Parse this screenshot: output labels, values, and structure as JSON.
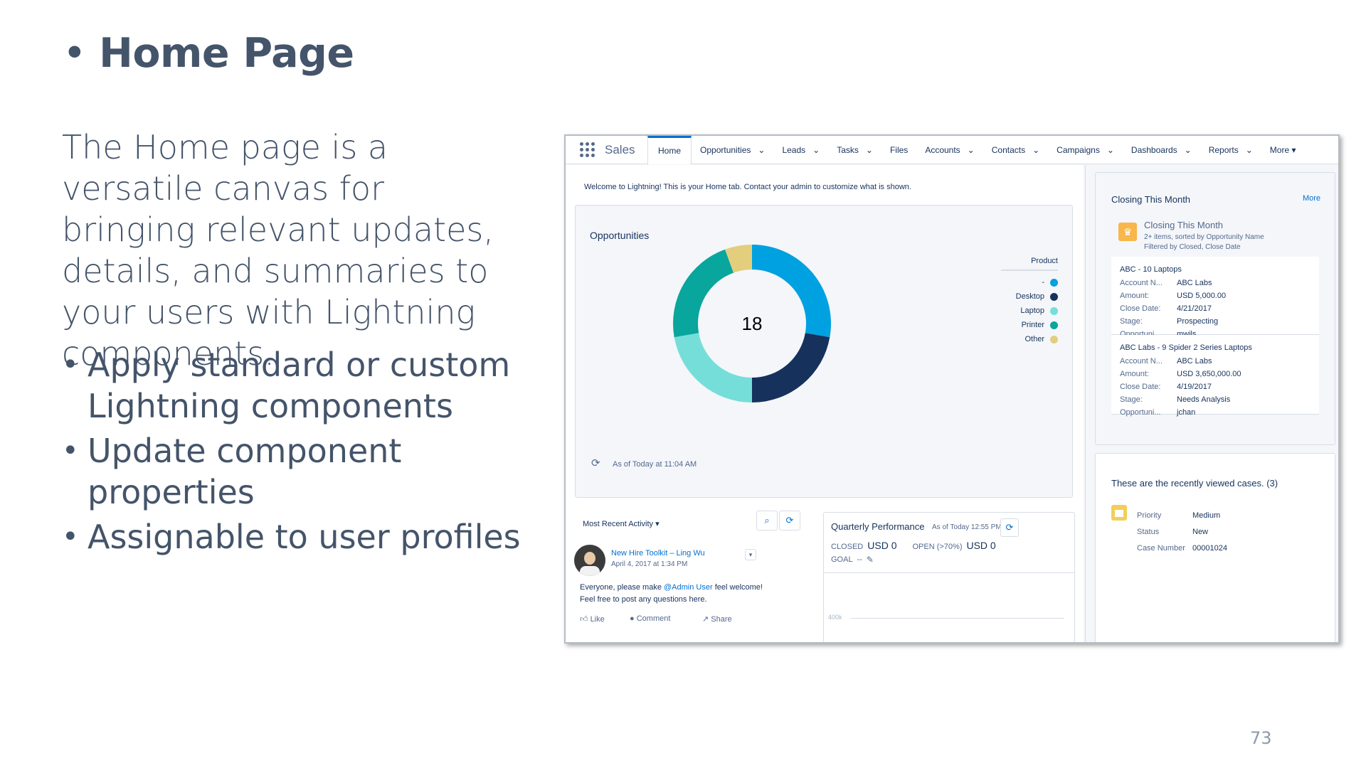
{
  "slide": {
    "title": "Home Page",
    "body": "The Home page is a versatile canvas for bringing relevant updates, details, and summaries to your users with Lightning components.",
    "bullets": [
      "Apply standard or custom Lightning components",
      "Update component properties",
      "Assignable to user profiles"
    ],
    "page_number": "73"
  },
  "app": {
    "name": "Sales",
    "tabs": [
      {
        "label": "Home",
        "active": true,
        "dropdown": false
      },
      {
        "label": "Opportunities",
        "dropdown": true
      },
      {
        "label": "Leads",
        "dropdown": true
      },
      {
        "label": "Tasks",
        "dropdown": true
      },
      {
        "label": "Files",
        "dropdown": false
      },
      {
        "label": "Accounts",
        "dropdown": true
      },
      {
        "label": "Contacts",
        "dropdown": true
      },
      {
        "label": "Campaigns",
        "dropdown": true
      },
      {
        "label": "Dashboards",
        "dropdown": true
      },
      {
        "label": "Reports",
        "dropdown": true
      },
      {
        "label": "More ▾",
        "dropdown": false
      }
    ],
    "welcome": "Welcome to Lightning!  This is your Home tab.  Contact your admin to customize what is shown."
  },
  "opportunities": {
    "title": "Opportunities",
    "center_value": "18",
    "legend_title": "Product",
    "as_of": "As of Today at 11:04 AM"
  },
  "chart_data": {
    "type": "pie",
    "title": "Opportunities",
    "legend_title": "Product",
    "center_label": "18",
    "series": [
      {
        "name": "-",
        "value": 5,
        "color": "#00a1e0"
      },
      {
        "name": "Desktop",
        "value": 4,
        "color": "#16325c"
      },
      {
        "name": "Laptop",
        "value": 4,
        "color": "#76ded9"
      },
      {
        "name": "Printer",
        "value": 4,
        "color": "#08a69c"
      },
      {
        "name": "Other",
        "value": 1,
        "color": "#e2ce7d"
      }
    ]
  },
  "activity": {
    "title": "Most Recent Activity",
    "post_link": "New Hire Toolkit – Ling Wu",
    "post_date": "April 4, 2017 at 1:34 PM",
    "message_pre": "Everyone, please make ",
    "mention": "@Admin User",
    "message_post": " feel welcome!",
    "message_line2": "Feel free to post any questions here.",
    "actions": [
      "Like",
      "Comment",
      "Share"
    ]
  },
  "quarterly": {
    "title": "Quarterly Performance",
    "as_of": "As of Today 12:55 PM",
    "closed_label": "CLOSED",
    "closed_value": "USD 0",
    "open_label": "OPEN (>70%)",
    "open_value": "USD 0",
    "goal_label": "GOAL",
    "goal_value": "--",
    "axis_label": "400k"
  },
  "closing": {
    "title": "Closing This Month",
    "more": "More",
    "sub_title": "Closing This Month",
    "sub_line1": "2+ items, sorted by Opportunity Name",
    "sub_line2": "Filtered by Closed, Close Date",
    "records": [
      {
        "name": "ABC - 10 Laptops",
        "fields": [
          [
            "Account N...",
            "ABC Labs"
          ],
          [
            "Amount:",
            "USD 5,000.00"
          ],
          [
            "Close Date:",
            "4/21/2017"
          ],
          [
            "Stage:",
            "Prospecting"
          ],
          [
            "Opportuni...",
            "mwils"
          ]
        ]
      },
      {
        "name": "ABC Labs - 9 Spider 2 Series Laptops",
        "fields": [
          [
            "Account N...",
            "ABC Labs"
          ],
          [
            "Amount:",
            "USD 3,650,000.00"
          ],
          [
            "Close Date:",
            "4/19/2017"
          ],
          [
            "Stage:",
            "Needs Analysis"
          ],
          [
            "Opportuni...",
            "jchan"
          ]
        ]
      }
    ]
  },
  "cases": {
    "title": "These are the recently viewed cases. (3)",
    "fields": [
      [
        "Priority",
        "Medium"
      ],
      [
        "Status",
        "New"
      ],
      [
        "Case Number",
        "00001024"
      ]
    ]
  },
  "colors": {
    "brand": "#0070d2",
    "text": "#16325c",
    "slide_text": "#44546a"
  }
}
